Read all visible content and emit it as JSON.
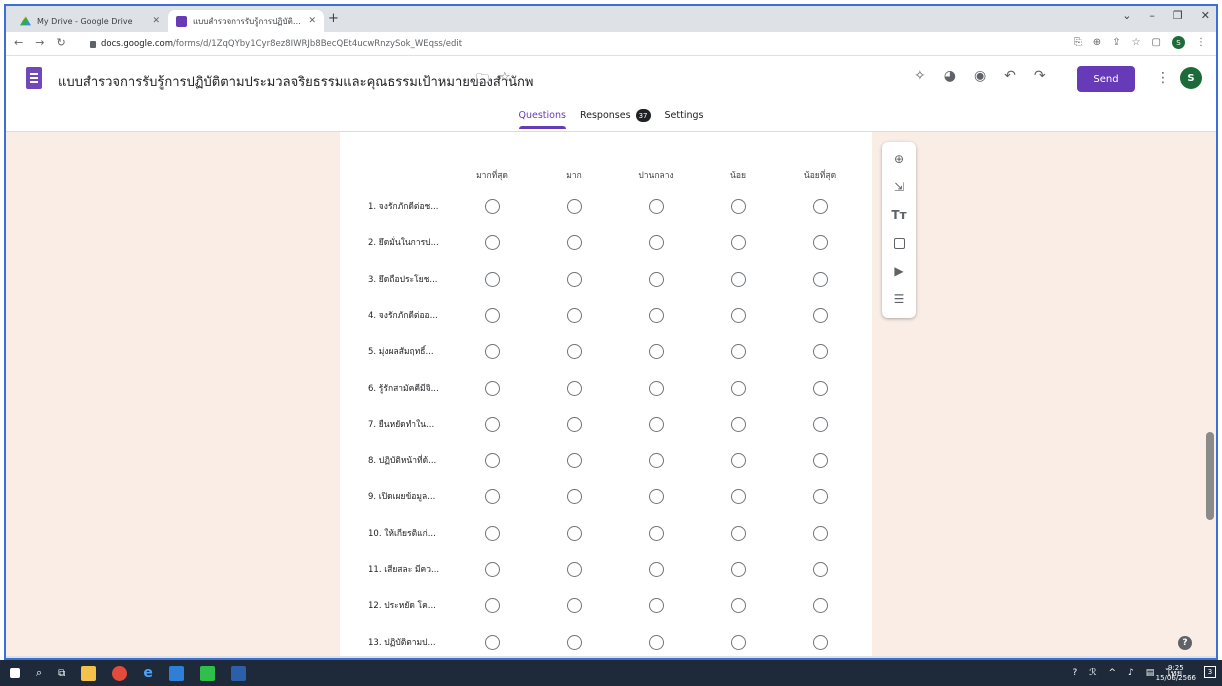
{
  "browser": {
    "tabs": [
      {
        "title": "My Drive - Google Drive",
        "active": false
      },
      {
        "title": "แบบสำรวจการรับรู้การปฏิบัติตามประ",
        "active": true
      }
    ],
    "url_host": "docs.google.com",
    "url_path": "/forms/d/1ZqQYby1Cyr8ez8IWRJb8BecQEt4ucwRnzySok_WEqss/edit"
  },
  "form": {
    "title": "แบบสำรวจการรับรู้การปฏิบัติตามประมวลจริยธรรมและคุณธรรมเป้าหมายของสำนักพ",
    "send_label": "Send",
    "avatar_initial": "S",
    "tabs": [
      {
        "label": "Questions",
        "active": true
      },
      {
        "label": "Responses",
        "badge": "37"
      },
      {
        "label": "Settings"
      }
    ]
  },
  "grid": {
    "columns": [
      "มากที่สุด",
      "มาก",
      "ปานกลาง",
      "น้อย",
      "น้อยที่สุด"
    ],
    "rows": [
      "1. จงรักภักดีต่อช...",
      "2. ยึดมั่นในการป...",
      "3. ยึดถือประโยช...",
      "4. จงรักภักดีต่ออ...",
      "5. มุ่งผลสัมฤทธิ์...",
      "6. รู้รักสามัคคีมีจิ...",
      "7. ยืนหยัดทำใน...",
      "8. ปฏิบัติหน้าที่ด้...",
      "9. เปิดเผยข้อมูล...",
      "10. ให้เกียรติแก่...",
      "11. เสียสละ มีคว...",
      "12. ประหยัด โค...",
      "13. ปฏิบัติตามป..."
    ]
  },
  "colors": {
    "accent": "#673ab7",
    "background": "#f9ede6"
  },
  "taskbar": {
    "time": "9:25",
    "date": "15/06/2566",
    "lang": "ไทย",
    "notifications": "3"
  }
}
